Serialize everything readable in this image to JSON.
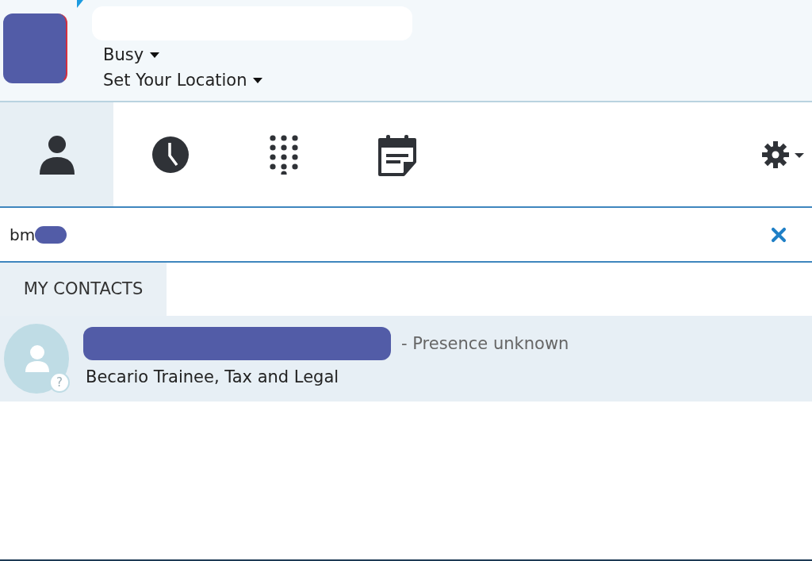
{
  "profile": {
    "status": "Busy",
    "location": "Set Your Location"
  },
  "tabs": [
    {
      "kind": "contacts",
      "selected": true
    },
    {
      "kind": "history",
      "selected": false
    },
    {
      "kind": "dialpad",
      "selected": false
    },
    {
      "kind": "meetings",
      "selected": false
    }
  ],
  "search": {
    "value": "bm"
  },
  "list_tabs": [
    {
      "label": "MY CONTACTS",
      "selected": true
    }
  ],
  "contacts": [
    {
      "presence": "- Presence unknown",
      "title": "Becario Trainee, Tax and Legal",
      "badge": "?",
      "selected": true
    }
  ]
}
